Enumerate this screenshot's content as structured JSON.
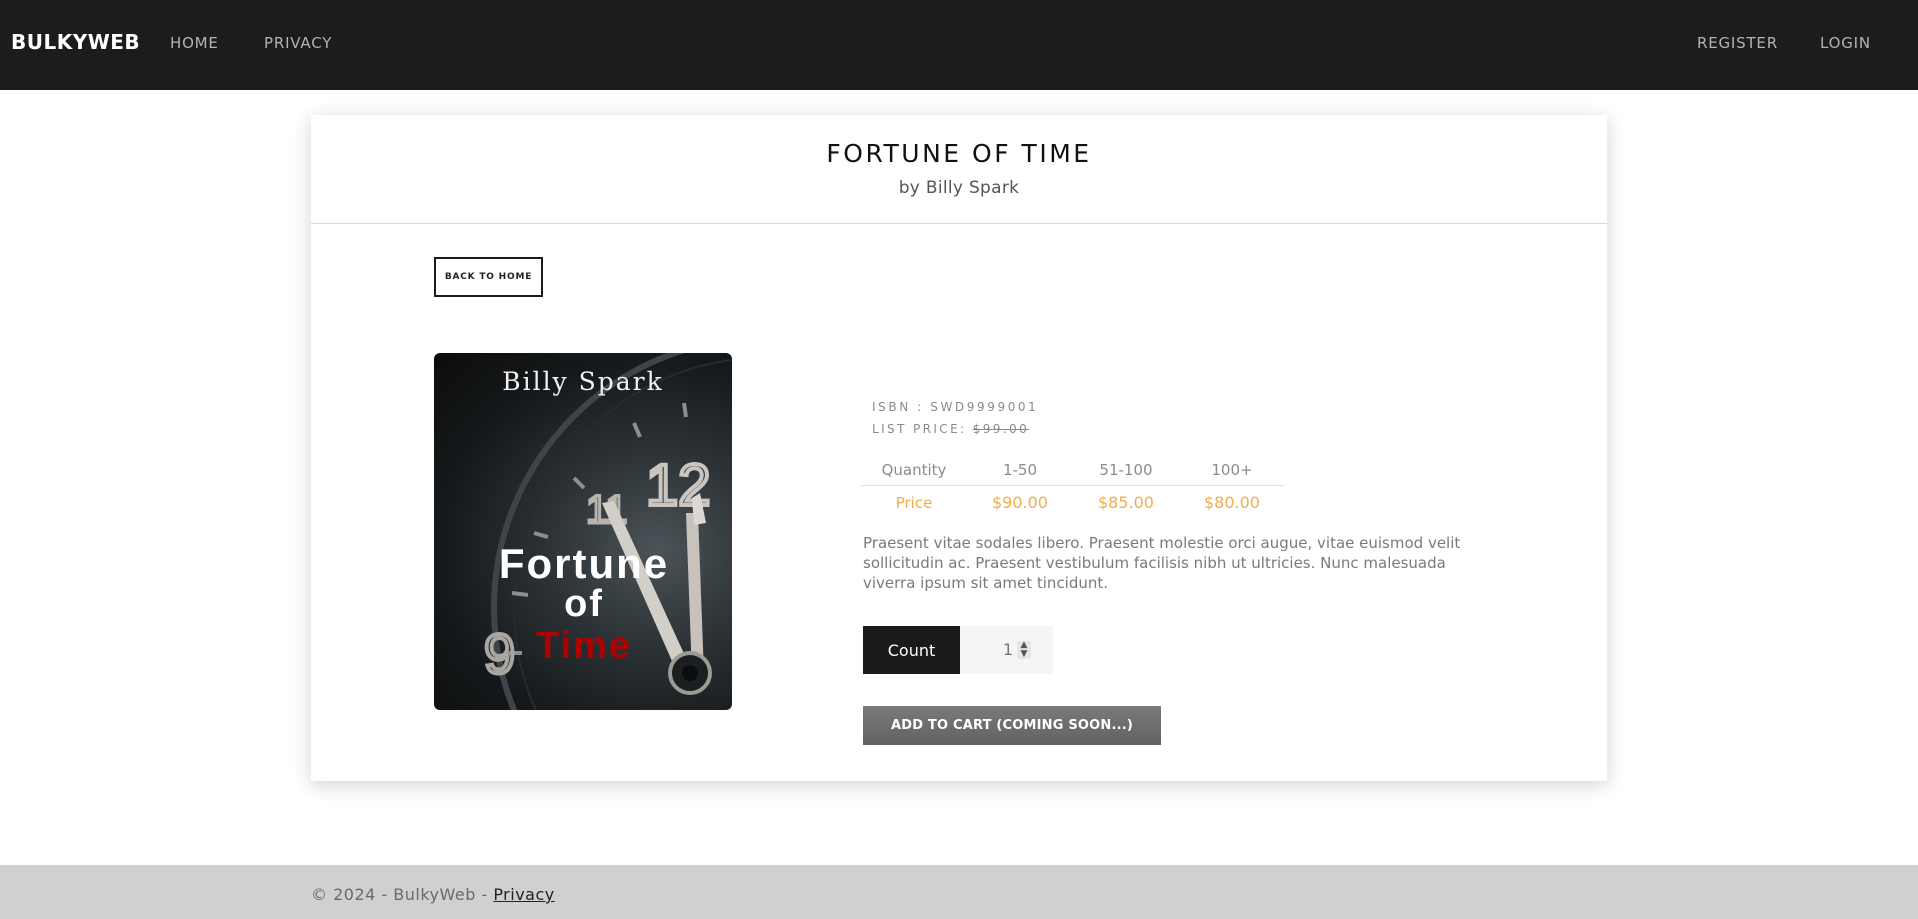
{
  "navbar": {
    "brand": "BULKYWEB",
    "links": [
      "HOME",
      "PRIVACY"
    ],
    "right_links": [
      "REGISTER",
      "LOGIN"
    ],
    "background": "#1c1c1c"
  },
  "product": {
    "title": "FORTUNE OF TIME",
    "author": "by Billy Spark",
    "back_label": "BACK TO HOME",
    "cover": {
      "author": "Billy Spark",
      "title_line1": "Fortune",
      "title_line2": "of",
      "title_line3": "Time"
    },
    "isbn_label": "ISBN : SWD9999001",
    "list_price_label": "LIST PRICE:",
    "list_price_value": "$99.00",
    "price_table": {
      "headers": [
        "Quantity",
        "1-50",
        "51-100",
        "100+"
      ],
      "row": [
        "Price",
        "$90.00",
        "$85.00",
        "$80.00"
      ]
    },
    "description": "Praesent vitae sodales libero. Praesent molestie orci augue, vitae euismod velit sollicitudin ac. Praesent vestibulum facilisis nibh ut ultricies.  Nunc malesuada viverra ipsum sit amet tincidunt.",
    "count_label": "Count",
    "count_value": "1",
    "add_to_cart_label": "ADD TO CART (COMING SOON...)",
    "accent_color": "#f0ad4e"
  },
  "footer": {
    "text": "© 2024 - BulkyWeb - ",
    "link": "Privacy"
  }
}
